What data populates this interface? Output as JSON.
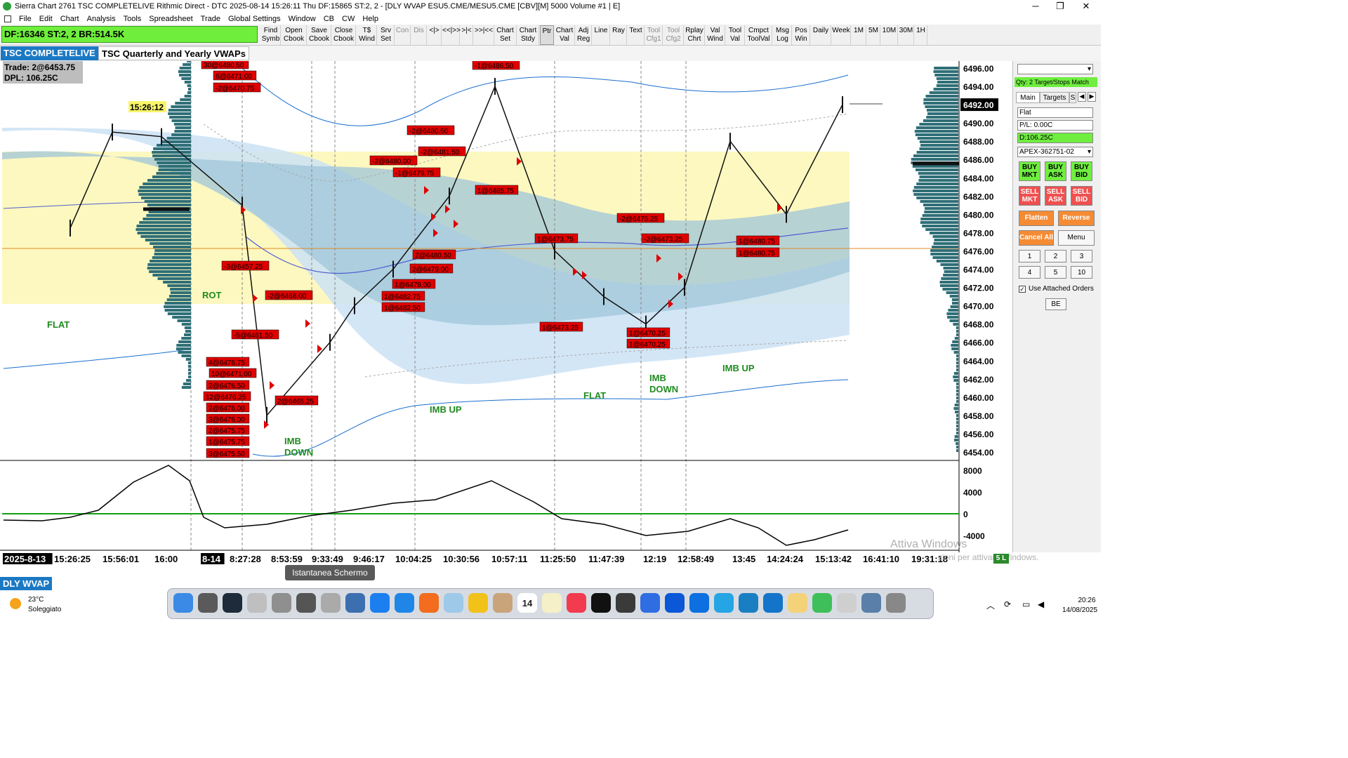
{
  "window": {
    "title": "Sierra Chart 2761 TSC COMPLETELIVE Rithmic Direct - DTC 2025-08-14  15:26:11 Thu DF:15865  ST:2, 2 - [DLY WVAP ESU5.CME/MESU5.CME [CBV][M]  5000 Volume #1 | E]",
    "controls": [
      "─",
      "❐",
      "✕"
    ]
  },
  "menu": [
    "File",
    "Edit",
    "Chart",
    "Analysis",
    "Tools",
    "Spreadsheet",
    "Trade",
    "Global Settings",
    "Window",
    "CB",
    "CW",
    "Help"
  ],
  "toolbar": {
    "status": "DF:16346  ST:2, 2  BR:514.5K",
    "buttons": [
      {
        "l1": "Find",
        "l2": "Symb"
      },
      {
        "l1": "Open",
        "l2": "Cbook"
      },
      {
        "l1": "Save",
        "l2": "Cbook"
      },
      {
        "l1": "Close",
        "l2": "Cbook"
      },
      {
        "l1": "T$",
        "l2": "Wind"
      },
      {
        "l1": "Srv",
        "l2": "Set"
      },
      {
        "l1": "Con",
        "l2": ""
      },
      {
        "l1": "Dis",
        "l2": ""
      },
      {
        "l1": "<|>",
        "l2": ""
      },
      {
        "l1": "<<|>>",
        "l2": ""
      },
      {
        "l1": ">|<",
        "l2": ""
      },
      {
        "l1": ">>|<<",
        "l2": ""
      },
      {
        "l1": "Chart",
        "l2": "Set"
      },
      {
        "l1": "Chart",
        "l2": "Stdy"
      },
      {
        "l1": "Ptr",
        "l2": ""
      },
      {
        "l1": "Chart",
        "l2": "Val"
      },
      {
        "l1": "Adj",
        "l2": "Reg"
      },
      {
        "l1": "Line",
        "l2": ""
      },
      {
        "l1": "Ray",
        "l2": ""
      },
      {
        "l1": "Text",
        "l2": ""
      },
      {
        "l1": "Tool",
        "l2": "Cfg1"
      },
      {
        "l1": "Tool",
        "l2": "Cfg2"
      },
      {
        "l1": "Rplay",
        "l2": "Chrt"
      },
      {
        "l1": "Val",
        "l2": "Wind"
      },
      {
        "l1": "Tool",
        "l2": "Val"
      },
      {
        "l1": "Cmpct",
        "l2": "ToolVal"
      },
      {
        "l1": "Msg",
        "l2": "Log"
      },
      {
        "l1": "Pos",
        "l2": "Win"
      },
      {
        "l1": "Daily",
        "l2": ""
      },
      {
        "l1": "Week",
        "l2": ""
      },
      {
        "l1": "1M",
        "l2": ""
      },
      {
        "l1": "5M",
        "l2": ""
      },
      {
        "l1": "10M",
        "l2": ""
      },
      {
        "l1": "30M",
        "l2": ""
      },
      {
        "l1": "1H",
        "l2": ""
      }
    ]
  },
  "tabs": [
    "TSC COMPLETELIVE",
    "TSC Quarterly and Yearly VWAPs"
  ],
  "chart": {
    "info_trade": "Trade: 2@6453.75",
    "info_dpl": "DPL: 106.25C",
    "time_marker": "15:26:12",
    "last_price": "6492.00",
    "price_axis": [
      "6496.00",
      "6494.00",
      "6492.00",
      "6490.00",
      "6488.00",
      "6486.00",
      "6484.00",
      "6482.00",
      "6480.00",
      "6478.00",
      "6476.00",
      "6474.00",
      "6472.00",
      "6470.00",
      "6468.00",
      "6466.00",
      "6464.00",
      "6462.00",
      "6460.00",
      "6458.00",
      "6456.00",
      "6454.00"
    ],
    "volume_axis": [
      "8000",
      "4000",
      "0",
      "-4000"
    ],
    "time_axis": [
      "2025-8-13",
      "15:26:25",
      "15:56:01",
      "16:00",
      "8-14",
      "8:27:28",
      "8:53:59",
      "9:33:49",
      "9:46:17",
      "10:04:25",
      "10:30:56",
      "10:57:11",
      "11:25:50",
      "11:47:39",
      "12:19",
      "12:58:49",
      "13:45",
      "14:24:24",
      "15:13:42",
      "16:41:10",
      "19:31:18"
    ],
    "regime_labels": [
      {
        "text": "FLAT",
        "color": "#1f8a1f"
      },
      {
        "text": "ROT",
        "color": "#1f8a1f"
      },
      {
        "text": "IMB\nDOWN",
        "color": "#1f8a1f"
      },
      {
        "text": "IMB UP",
        "color": "#1f8a1f"
      },
      {
        "text": "FLAT",
        "color": "#1f8a1f"
      },
      {
        "text": "IMB\nDOWN",
        "color": "#1f8a1f"
      },
      {
        "text": "IMB UP",
        "color": "#1f8a1f"
      }
    ],
    "trade_labels": [
      "30@6480.50",
      "6@6471.00",
      "-2@6470.75",
      "-3@6457.25",
      "-5@6461.50",
      "4@6476.75",
      "10@6471.00",
      "2@6476.50",
      "12@6476.25",
      "2@6476.00",
      "3@6476.00",
      "2@6475.75",
      "1@6475.75",
      "3@6475.50",
      "-2@6468.00",
      "2@6465.25",
      "-2@6480.00",
      "-2@6480.50",
      "-2@6481.50",
      "-1@6479.75",
      "2@6480.50",
      "2@6479.00",
      "1@6478.00",
      "1@6482.75",
      "1@6482.50",
      "-1@6486.50",
      "1@6485.75",
      "1@6473.75",
      "1@6473.25",
      "-2@6475.25",
      "-2@6473.25",
      "1@6470.25",
      "1@6470.25",
      "1@6480.75",
      "1@6480.75"
    ],
    "colors": {
      "buy_marker": "#e00000",
      "label_bg": "#e00000",
      "vwap_fill_yellow": "#fdf8bf",
      "vwap_band_blue": "#cbe2f5",
      "profile": "#2f6f77",
      "zero_line": "#12a012"
    }
  },
  "chart_data": {
    "type": "line",
    "title": "",
    "x": [
      "15:26:25",
      "15:56:01",
      "16:00",
      "8:27:28",
      "8:53:59",
      "9:33:49",
      "9:46:17",
      "10:04:25",
      "10:30:56",
      "10:57:11",
      "11:25:50",
      "11:47:39",
      "12:19",
      "12:58:49",
      "13:45",
      "14:24:24",
      "15:13:42"
    ],
    "series": [
      {
        "values": [
          6478.5,
          6489,
          6488.5,
          6481,
          6458,
          6466,
          6470,
          6474,
          6482,
          6494,
          6476,
          6471,
          6468,
          6472,
          6488,
          6480,
          6492
        ]
      }
    ],
    "ylim": [
      6454,
      6496
    ]
  },
  "right_panel": {
    "qty_label": "Qty: 2 Target/Stops Match",
    "tabs": [
      "Main",
      "Targets",
      "S"
    ],
    "position": "Flat",
    "pl": "P/L: 0.00C",
    "daily": "D:106.25C",
    "account": "APEX-362751-02",
    "buy_buttons": [
      {
        "l1": "BUY",
        "l2": "MKT"
      },
      {
        "l1": "BUY",
        "l2": "ASK"
      },
      {
        "l1": "BUY",
        "l2": "BID"
      }
    ],
    "sell_buttons": [
      {
        "l1": "SELL",
        "l2": "MKT"
      },
      {
        "l1": "SELL",
        "l2": "ASK"
      },
      {
        "l1": "SELL",
        "l2": "BID"
      }
    ],
    "flatten": "Flatten",
    "reverse": "Reverse",
    "cancel_all": "Cancel All",
    "menu": "Menu",
    "qty_buttons": [
      "1",
      "2",
      "3",
      "4",
      "5",
      "10"
    ],
    "use_attached": "Use Attached Orders",
    "be": "BE"
  },
  "bottom": {
    "tab": "DLY WVAP",
    "tooltip": "Istantanea Schermo",
    "watermark1": "Attiva Windows",
    "watermark2": "zioni per attivare Windows.",
    "indicator": "5 L"
  },
  "taskbar": {
    "weather_temp": "23°C",
    "weather_desc": "Soleggiato",
    "time": "20:26",
    "date": "14/08/2025",
    "calendar_day": "14"
  }
}
